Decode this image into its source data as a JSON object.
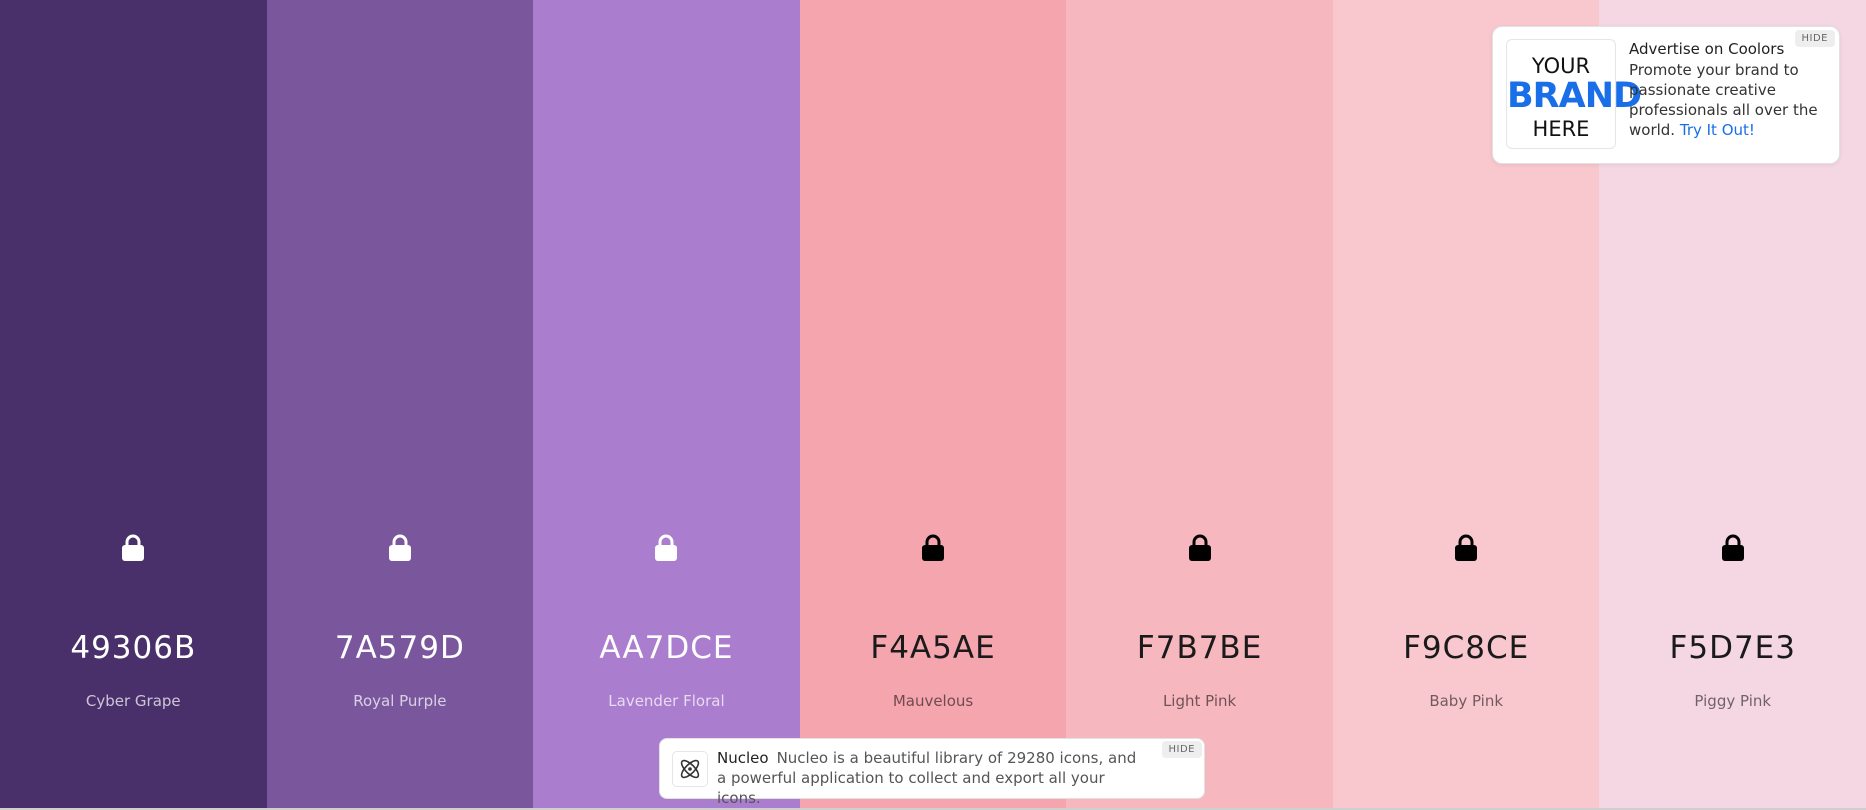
{
  "palette": [
    {
      "hex": "49306B",
      "name": "Cyber Grape",
      "bg": "#49306B",
      "tone": "light",
      "lock_icon": "lock-icon"
    },
    {
      "hex": "7A579D",
      "name": "Royal Purple",
      "bg": "#7A579D",
      "tone": "light",
      "lock_icon": "lock-icon"
    },
    {
      "hex": "AA7DCE",
      "name": "Lavender Floral",
      "bg": "#AA7DCE",
      "tone": "light",
      "lock_icon": "lock-icon"
    },
    {
      "hex": "F4A5AE",
      "name": "Mauvelous",
      "bg": "#F4A5AE",
      "tone": "dark",
      "lock_icon": "lock-icon"
    },
    {
      "hex": "F7B7BE",
      "name": "Light Pink",
      "bg": "#F7B7BE",
      "tone": "dark",
      "lock_icon": "lock-icon"
    },
    {
      "hex": "F9C8CE",
      "name": "Baby Pink",
      "bg": "#F9C8CE",
      "tone": "dark",
      "lock_icon": "lock-icon"
    },
    {
      "hex": "F5D7E3",
      "name": "Piggy Pink",
      "bg": "#F5D7E3",
      "tone": "dark",
      "lock_icon": "lock-icon"
    }
  ],
  "ad_card": {
    "brand_line1": "YOUR",
    "brand_line2": "BRAND",
    "brand_line3": "HERE",
    "title": "Advertise on Coolors",
    "text": "Promote your brand to passionate creative professionals all over the world.",
    "link": "Try It Out!",
    "hide_label": "HIDE",
    "accent": "#1a6fe8"
  },
  "ad_bar": {
    "brand": "Nucleo",
    "text": "Nucleo is a beautiful library of 29280 icons, and a powerful application to collect and export all your icons.",
    "hide_label": "HIDE",
    "logo_icon": "atom-icon"
  }
}
